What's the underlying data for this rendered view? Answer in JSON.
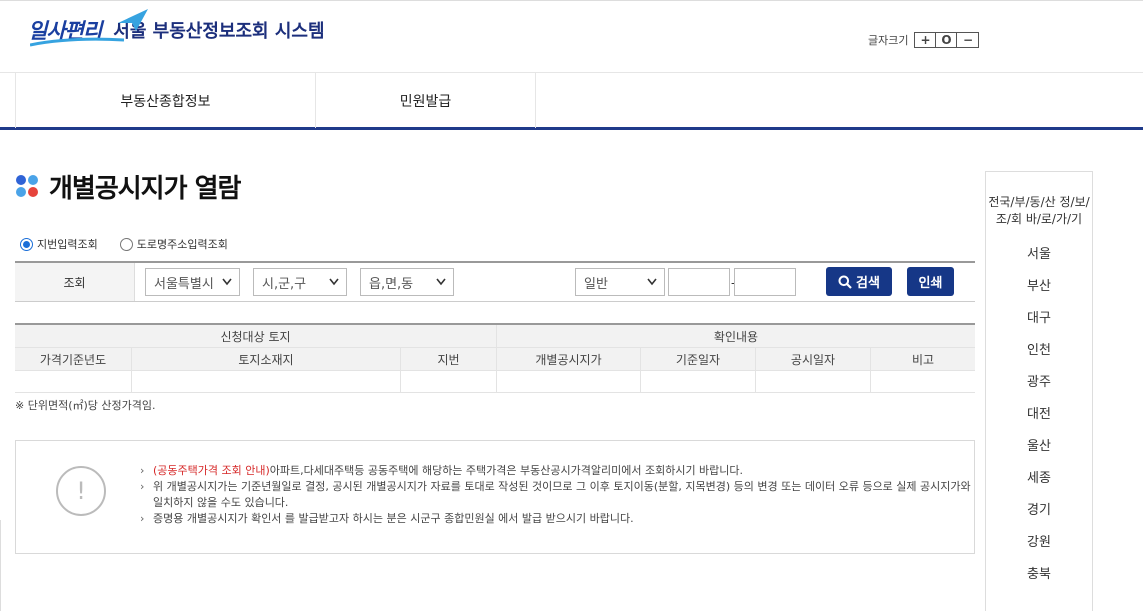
{
  "header": {
    "logo_text": "일사편리",
    "system_title": "서울 부동산정보조회 시스템",
    "font_size_label": "글자크기",
    "font_size_buttons": [
      "+",
      "O",
      "−"
    ]
  },
  "nav": {
    "items": [
      "부동산종합정보",
      "민원발급"
    ]
  },
  "page": {
    "title": "개별공시지가 열람"
  },
  "search_mode": {
    "options": [
      {
        "label": "지번입력조회",
        "checked": true
      },
      {
        "label": "도로명주소입력조회",
        "checked": false
      }
    ]
  },
  "search": {
    "label": "조회",
    "sido": "서울특별시",
    "sigungu": "시,군,구",
    "eupmyeondong": "읍,면,동",
    "land_type": "일반",
    "main_no": "",
    "sub_no": "",
    "dash": "-",
    "search_button": "검색",
    "print_button": "인쇄"
  },
  "table": {
    "group_headers": [
      "신청대상 토지",
      "확인내용"
    ],
    "columns": [
      "가격기준년도",
      "토지소재지",
      "지번",
      "개별공시지가",
      "기준일자",
      "공시일자",
      "비고"
    ]
  },
  "note": "※ 단위면적(㎡)당 산정가격임.",
  "info": {
    "item1_red": "(공동주택가격 조회 안내)",
    "item1_rest": "아파트,다세대주택등 공동주택에 해당하는 주택가격은 부동산공시가격알리미에서 조회하시기 바랍니다.",
    "item2": "위 개별공시지가는 기준년월일로 결정, 공시된 개별공시지가 자료를 토대로 작성된 것이므로 그 이후 토지이동(분할, 지목변경) 등의 변경 또는 데이터 오류 등으로 실제 공시지가와 일치하지 않을 수도 있습니다.",
    "item3": "증명용 개별공시지가 확인서 를 발급받고자 하시는 분은 시군구 종합민원실 에서 발급 받으시기 바랍니다."
  },
  "sidebar": {
    "title": "전국/부/동/산 정/보/조/회 바/로/가/기",
    "regions": [
      "서울",
      "부산",
      "대구",
      "인천",
      "광주",
      "대전",
      "울산",
      "세종",
      "경기",
      "강원",
      "충북"
    ]
  },
  "colors": {
    "primary": "#163787",
    "nav_border": "#1f3a8a",
    "red": "#d62828"
  }
}
